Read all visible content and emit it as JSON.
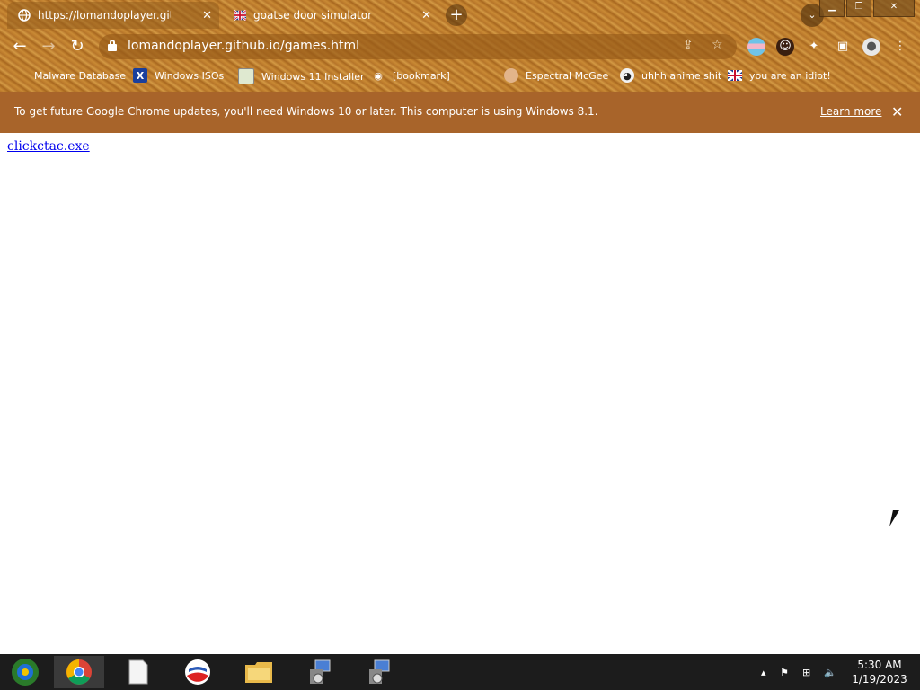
{
  "tabs": [
    {
      "title": "https://lomandoplayer.github.io/g",
      "active": true,
      "icon": "globe-icon"
    },
    {
      "title": "goatse door simulator",
      "active": false,
      "icon": "union-jack-icon"
    }
  ],
  "window_controls": {
    "minimize": "▁",
    "maximize": "❐",
    "close": "✕"
  },
  "toolbar": {
    "url": "lomandoplayer.github.io/games.html"
  },
  "bookmarks": [
    {
      "label": "Malware Database",
      "icon": "bookmark-icon"
    },
    {
      "label": "Windows ISOs",
      "icon": "x-logo-icon"
    },
    {
      "label": "Windows 11 Installer",
      "icon": "image-icon"
    },
    {
      "label": "[bookmark]",
      "icon": "disc-icon"
    },
    {
      "label": "Espectral McGee",
      "icon": "face-icon"
    },
    {
      "label": "uhhh anime shit",
      "icon": "anime-face-icon"
    },
    {
      "label": "you are an idiot!",
      "icon": "union-jack-icon"
    }
  ],
  "infobar": {
    "message": "To get future Google Chrome updates, you'll need Windows 10 or later. This computer is using Windows 8.1.",
    "link": "Learn more"
  },
  "page": {
    "link_text": "clickctac.exe"
  },
  "clock": {
    "time": "5:30 AM",
    "date": "1/19/2023"
  }
}
